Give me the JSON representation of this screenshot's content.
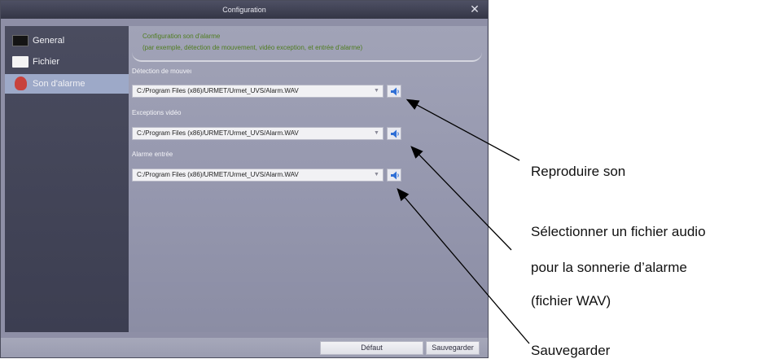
{
  "window": {
    "title": "Configuration"
  },
  "sidebar": {
    "items": [
      {
        "label": "General",
        "icon": "monitor-icon"
      },
      {
        "label": "Fichier",
        "icon": "folder-icon"
      },
      {
        "label": "Son d'alarme",
        "icon": "alarm-bell-icon",
        "selected": true
      }
    ]
  },
  "content": {
    "info_line1": "Configuration son d'alarme",
    "info_line2": "(par exemple, détection de mouvement, vidéo exception, et entrée d'alarme)",
    "sections": [
      {
        "label": "Détection de mouveı",
        "value": "C:/Program Files (x86)/URMET/Urmet_UVS/Alarm.WAV"
      },
      {
        "label": "Exceptions vidéo",
        "value": "C:/Program Files (x86)/URMET/Urmet_UVS/Alarm.WAV"
      },
      {
        "label": "Alarme entrée",
        "value": "C:/Program Files (x86)/URMET/Urmet_UVS/Alarm.WAV"
      }
    ]
  },
  "buttons": {
    "default": "Défaut",
    "save": "Sauvegarder"
  },
  "callouts": {
    "play": "Reproduire son",
    "select_line1": "Sélectionner un fichier audio",
    "select_line2": "pour la sonnerie d’alarme",
    "select_line3": "(fichier WAV)",
    "save": "Sauvegarder"
  },
  "colors": {
    "accent_green": "#4f7d1f",
    "selected_item": "#9da9c8",
    "speaker_blue": "#2f6fd6"
  }
}
